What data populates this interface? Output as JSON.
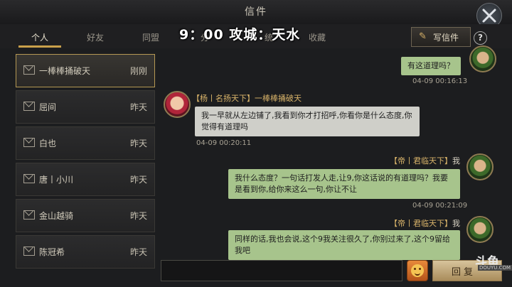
{
  "title": "信件",
  "overlay_time": "9：00 攻城：天水",
  "tabs": [
    {
      "label": "个人",
      "active": true
    },
    {
      "label": "好友",
      "active": false
    },
    {
      "label": "同盟",
      "active": false
    },
    {
      "label": "分 ",
      "active": false
    },
    {
      "label": "统",
      "active": false
    },
    {
      "label": "收藏",
      "active": false
    }
  ],
  "write_button": "写信件",
  "help_button": "?",
  "contacts": [
    {
      "name": "一棒棒捅破天",
      "time": "刚刚",
      "active": true
    },
    {
      "name": "屈间",
      "time": "昨天",
      "active": false
    },
    {
      "name": "白也",
      "time": "昨天",
      "active": false
    },
    {
      "name": "唐丨小川",
      "time": "昨天",
      "active": false
    },
    {
      "name": "金山越骑",
      "time": "昨天",
      "active": false
    },
    {
      "name": "陈冠希",
      "time": "昨天",
      "active": false
    }
  ],
  "messages": [
    {
      "direction": "out",
      "text": "有这道理吗？",
      "timestamp": "04-09 00:16:13"
    },
    {
      "direction": "in",
      "sender": "【杨丨名扬天下】一棒棒捅破天",
      "text": "我一早就从左边铺了,我看到你才打招呼,你看你是什么态度,你觉得有道理吗",
      "timestamp": "04-09 00:20:11"
    },
    {
      "direction": "out",
      "sender": "【帝丨君临天下】",
      "me": "我",
      "text": "我什么态度？一句话打发人走,让9,你这话说的有道理吗？我要是看到你,给你来这么一句,你让不让",
      "timestamp": "04-09 00:21:09"
    },
    {
      "direction": "out",
      "sender": "【帝丨君临天下】",
      "me": "我",
      "text": "同样的话,我也会说,这个9我关注很久了,你别过来了,这个9留给我吧",
      "timestamp": ""
    }
  ],
  "reply_button": "回复",
  "watermark": {
    "big": "斗鱼",
    "small": "DOUYU.COM"
  },
  "colors": {
    "accent": "#c9a04b",
    "sender_name": "#d9b46a",
    "bubble_out": "#a7c48c",
    "bubble_in": "#cfcfc9"
  }
}
